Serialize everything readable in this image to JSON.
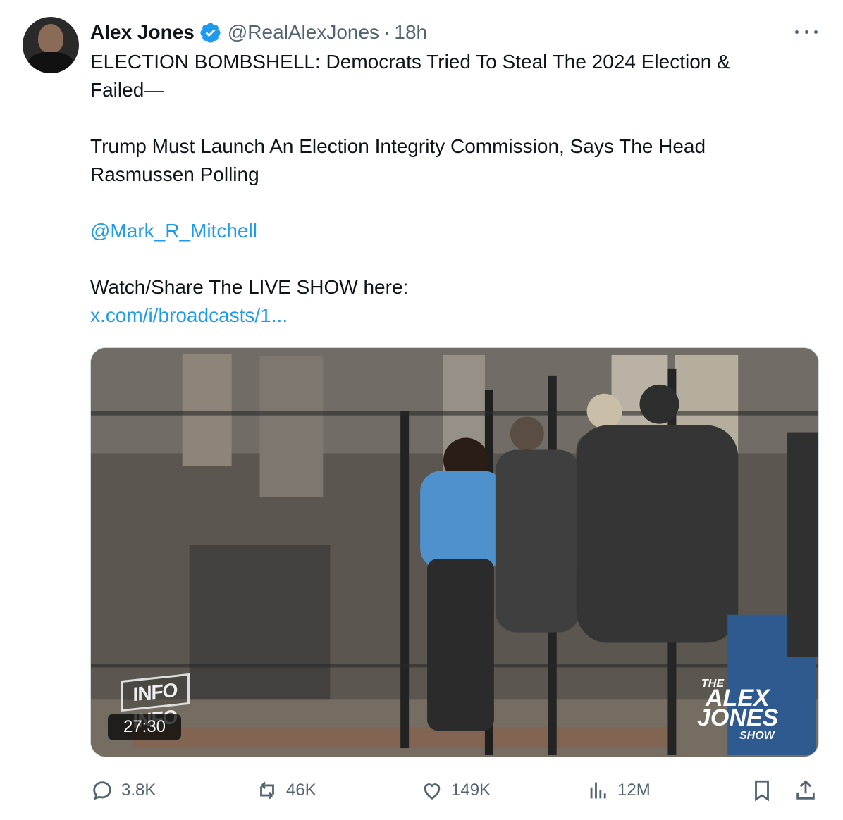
{
  "tweet": {
    "author_name": "Alex Jones",
    "handle": "@RealAlexJones",
    "separator": "·",
    "time": "18h",
    "text_line1": "ELECTION BOMBSHELL: Democrats Tried To Steal The 2024 Election &",
    "text_line2": "Failed—",
    "text_line3": "Trump Must Launch An Election Integrity Commission, Says The Head",
    "text_line4": "Rasmussen Polling",
    "mention": "@Mark_R_Mitchell",
    "text_line5": "Watch/Share The LIVE SHOW here:",
    "link": "x.com/i/broadcasts/1..."
  },
  "media": {
    "duration": "27:30",
    "logo_left": "INFO INFO",
    "logo_right_the": "THE",
    "logo_right_alex": "ALEX",
    "logo_right_jones": "JONES",
    "logo_right_show": "SHOW"
  },
  "actions": {
    "replies": "3.8K",
    "reposts": "46K",
    "likes": "149K",
    "views": "12M"
  },
  "icons": {
    "verified": "verified-badge-icon",
    "more": "more-icon",
    "reply": "reply-icon",
    "repost": "repost-icon",
    "like": "like-icon",
    "views": "views-icon",
    "bookmark": "bookmark-icon",
    "share": "share-icon"
  },
  "colors": {
    "link": "#1d9bf0",
    "secondary_text": "#536471",
    "primary_text": "#0f1419"
  }
}
